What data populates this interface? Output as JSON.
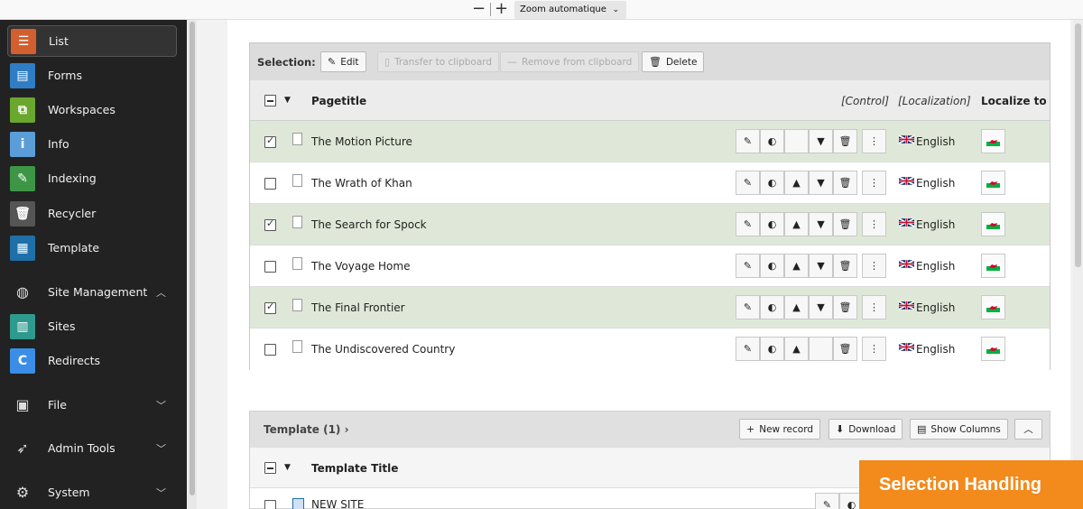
{
  "zoom": {
    "minus": "−",
    "plus": "+",
    "label": "Zoom automatique"
  },
  "sidebar": {
    "items": [
      {
        "label": "List",
        "icon": "list-icon",
        "color": "#d35f2e"
      },
      {
        "label": "Forms",
        "icon": "forms-icon",
        "color": "#2f7dc4"
      },
      {
        "label": "Workspaces",
        "icon": "workspaces-icon",
        "color": "#6aa72d"
      },
      {
        "label": "Info",
        "icon": "info-icon",
        "color": "#5b9dd9"
      },
      {
        "label": "Indexing",
        "icon": "indexing-icon",
        "color": "#3d9645"
      },
      {
        "label": "Recycler",
        "icon": "recycler-icon",
        "color": "#555555"
      },
      {
        "label": "Template",
        "icon": "template-icon",
        "color": "#1f6fa8"
      },
      {
        "label": "Site Management",
        "icon": "globe-icon"
      },
      {
        "label": "Sites",
        "icon": "sites-icon",
        "color": "#2e9a8e"
      },
      {
        "label": "Redirects",
        "icon": "redirects-icon",
        "color": "#3a8ee6"
      },
      {
        "label": "File",
        "icon": "image-icon"
      },
      {
        "label": "Admin Tools",
        "icon": "rocket-icon"
      },
      {
        "label": "System",
        "icon": "gear-icon"
      }
    ]
  },
  "selection": {
    "label": "Selection:",
    "edit": "Edit",
    "transfer": "Transfer to clipboard",
    "remove": "Remove from clipboard",
    "delete": "Delete"
  },
  "table": {
    "col_title": "Pagetitle",
    "col_control": "[Control]",
    "col_localization": "[Localization]",
    "col_localize": "Localize to",
    "rows": [
      {
        "title": "The Motion Picture",
        "selected": true,
        "lang": "English"
      },
      {
        "title": "The Wrath of Khan",
        "selected": false,
        "lang": "English"
      },
      {
        "title": "The Search for Spock",
        "selected": true,
        "lang": "English"
      },
      {
        "title": "The Voyage Home",
        "selected": false,
        "lang": "English"
      },
      {
        "title": "The Final Frontier",
        "selected": true,
        "lang": "English"
      },
      {
        "title": "The Undiscovered Country",
        "selected": false,
        "lang": "English"
      }
    ]
  },
  "template_panel": {
    "title": "Template (1)",
    "new_record": "New record",
    "download": "Download",
    "show_columns": "Show Columns",
    "col_title": "Template Title",
    "row": "NEW SITE"
  },
  "overlay": "Selection Handling",
  "colors": {
    "accent": "#f38a1c",
    "selected_row": "#dfe8d8"
  }
}
